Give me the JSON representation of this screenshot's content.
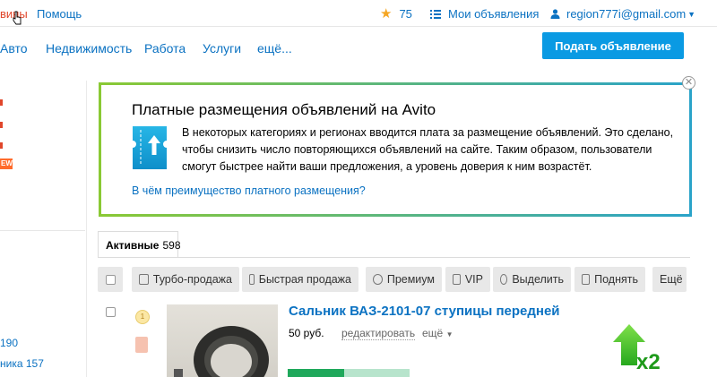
{
  "topbar": {
    "left_links": [
      "вины",
      "Помощь"
    ],
    "favorites_count": "75",
    "my_ads": "Мои объявления",
    "user_email": "region777i@gmail.com"
  },
  "nav": {
    "items": [
      "Авто",
      "Недвижимость",
      "Работа",
      "Услуги",
      "ещё..."
    ],
    "post_ad": "Подать объявление"
  },
  "sidebar": {
    "new_badge": "EW",
    "counts": [
      "190",
      "ника 157"
    ]
  },
  "notice": {
    "title": "Платные размещения объявлений на Avito",
    "body": "В некоторых категориях и регионах вводится плата за размещение объявлений. Это сделано, чтобы снизить число повторяющихся объявлений на сайте. Таким образом, пользователи смогут быстрее найти ваши предложения, а уровень доверия к ним возрастёт.",
    "link": "В чём преимущество платного размещения?"
  },
  "tabs": {
    "active_label": "Активные",
    "active_count": "598"
  },
  "toolbar": {
    "turbo": "Турбо-продажа",
    "fast": "Быстрая продажа",
    "premium": "Премиум",
    "vip": "VIP",
    "highlight": "Выделить",
    "raise": "Поднять",
    "more": "Ещё"
  },
  "listing": {
    "title": "Сальник ВАЗ-2101-07 ступицы передней",
    "price": "50 руб.",
    "edit": "редактировать",
    "more": "ещё",
    "badge_number": "1",
    "up_multiplier": "x2",
    "progress_percent": 46
  },
  "colors": {
    "link": "#0b72c2",
    "primary_button": "#0a9ae3",
    "accent_red": "#e0462b",
    "star": "#f5a623",
    "progress": "#1fa85b",
    "notice_border_start": "#8ac934",
    "notice_border_end": "#2aa3c9"
  }
}
